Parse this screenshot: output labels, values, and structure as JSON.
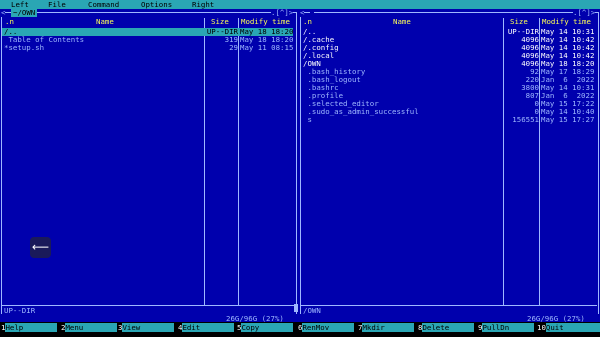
{
  "menu": {
    "items": [
      "Left",
      "File",
      "Command",
      "Options",
      "Right"
    ]
  },
  "left_panel": {
    "path": "~/OWN",
    "corner": ".[^]>",
    "headers": {
      "n": ".n",
      "name": "Name",
      "size": "Size",
      "mtime": "Modify time"
    },
    "rows": [
      {
        "name": "/..",
        "size": "UP--DIR",
        "mtime": "May 18 18:20",
        "type": "selected"
      },
      {
        "name": " Table of Contents",
        "size": "319",
        "mtime": "May 18 18:20",
        "type": "file"
      },
      {
        "name": "*setup.sh",
        "size": "29",
        "mtime": "May 11 08:15",
        "type": "file"
      }
    ],
    "status": "UP--DIR",
    "disk": "26G/96G (27%)"
  },
  "right_panel": {
    "path": "",
    "corner": ".[^]>",
    "headers": {
      "n": ".n",
      "name": "Name",
      "size": "Size",
      "mtime": "Modify time"
    },
    "rows": [
      {
        "name": "/..",
        "size": "UP--DIR",
        "mtime": "May 14 10:31",
        "type": "dir"
      },
      {
        "name": "/.cache",
        "size": "4096",
        "mtime": "May 14 10:42",
        "type": "dir"
      },
      {
        "name": "/.config",
        "size": "4096",
        "mtime": "May 14 10:42",
        "type": "dir"
      },
      {
        "name": "/.local",
        "size": "4096",
        "mtime": "May 14 10:42",
        "type": "dir"
      },
      {
        "name": "/OWN",
        "size": "4096",
        "mtime": "May 18 18:20",
        "type": "dir"
      },
      {
        "name": " .bash_history",
        "size": "92",
        "mtime": "May 17 18:29",
        "type": "file"
      },
      {
        "name": " .bash_logout",
        "size": "220",
        "mtime": "Jan  6  2022",
        "type": "file"
      },
      {
        "name": " .bashrc",
        "size": "3800",
        "mtime": "May 14 10:31",
        "type": "file"
      },
      {
        "name": " .profile",
        "size": "807",
        "mtime": "Jan  6  2022",
        "type": "file"
      },
      {
        "name": " .selected_editor",
        "size": "0",
        "mtime": "May 15 17:22",
        "type": "file"
      },
      {
        "name": " .sudo_as_admin_successful",
        "size": "0",
        "mtime": "May 14 10:40",
        "type": "file"
      },
      {
        "name": " s",
        "size": "156551",
        "mtime": "May 15 17:27",
        "type": "file"
      }
    ],
    "status": "/OWN",
    "disk": "26G/96G (27%)"
  },
  "floating_button": {
    "icon": "back-arrow-icon",
    "glyph": "⟵"
  },
  "fkeys": [
    {
      "num": "1",
      "label": "Help"
    },
    {
      "num": "2",
      "label": "Menu"
    },
    {
      "num": "3",
      "label": "View"
    },
    {
      "num": "4",
      "label": "Edit"
    },
    {
      "num": "5",
      "label": "Copy"
    },
    {
      "num": "6",
      "label": "RenMov"
    },
    {
      "num": "7",
      "label": "Mkdir"
    },
    {
      "num": "8",
      "label": "Delete"
    },
    {
      "num": "9",
      "label": "PullDn"
    },
    {
      "num": "10",
      "label": "Quit"
    }
  ],
  "colors": {
    "background": "#0000ad",
    "accent": "#2aa6b4",
    "header": "#ffff55",
    "text": "#9fb8ff"
  }
}
